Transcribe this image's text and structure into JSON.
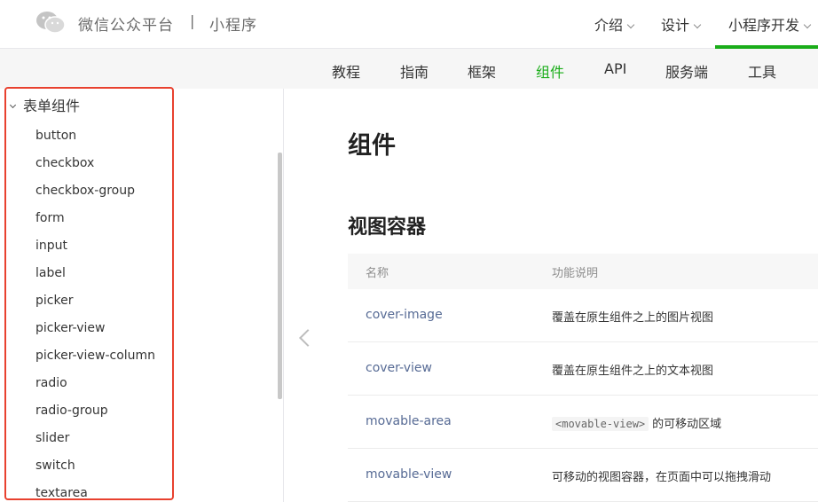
{
  "header": {
    "brand": "微信公众平台",
    "separator": "|",
    "subtitle": "小程序",
    "nav": [
      "介绍",
      "设计",
      "小程序开发"
    ]
  },
  "subnav": {
    "items": [
      "教程",
      "指南",
      "框架",
      "组件",
      "API",
      "服务端",
      "工具"
    ],
    "active": "组件"
  },
  "sidebar": {
    "group": "表单组件",
    "items": [
      "button",
      "checkbox",
      "checkbox-group",
      "form",
      "input",
      "label",
      "picker",
      "picker-view",
      "picker-view-column",
      "radio",
      "radio-group",
      "slider",
      "switch",
      "textarea"
    ]
  },
  "main": {
    "title": "组件",
    "section": "视图容器",
    "table": {
      "headers": [
        "名称",
        "功能说明"
      ],
      "rows": [
        {
          "name": "cover-image",
          "desc": "覆盖在原生组件之上的图片视图"
        },
        {
          "name": "cover-view",
          "desc": "覆盖在原生组件之上的文本视图"
        },
        {
          "name": "movable-area",
          "code": "<movable-view>",
          "desc": "的可移动区域"
        },
        {
          "name": "movable-view",
          "desc": "可移动的视图容器，在页面中可以拖拽滑动"
        }
      ]
    }
  },
  "colors": {
    "accent": "#1aad19",
    "link": "#576b95",
    "highlight": "#e8412f"
  }
}
